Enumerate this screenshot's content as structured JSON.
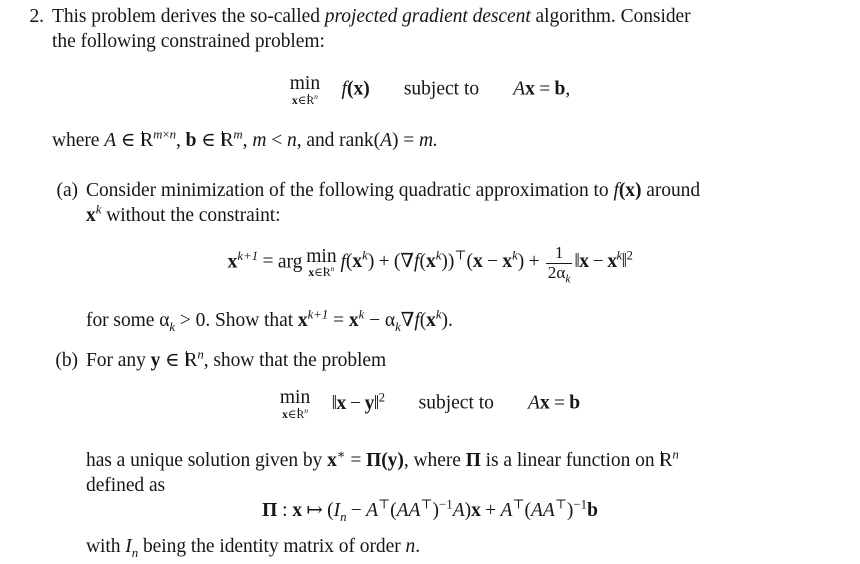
{
  "document": {
    "type": "math-exercise",
    "background_color": "#ffffff",
    "text_color": "#15161c",
    "problem_number": "2.",
    "intro": {
      "line1_before_italic": "This problem derives the so-called ",
      "line1_italic": "projected gradient descent",
      "line1_after_italic": " algorithm.  Consider",
      "line2": "the following constrained problem:"
    },
    "display1": {
      "min_label": "min",
      "min_sub_var": "x",
      "min_sub_in": "∈",
      "min_sub_set": "R",
      "min_sub_exp": "n",
      "objective_f": "f",
      "objective_arg": "(x)",
      "connector": "subject to",
      "constraint_A": "A",
      "constraint_x": "x",
      "constraint_eq": "=",
      "constraint_b": "b",
      "constraint_punct": ","
    },
    "where_line": {
      "lead": "where ",
      "A": "A",
      "in1": " ∈ ",
      "set1": "R",
      "set1_exp_m": "m",
      "set1_exp_times": "×",
      "set1_exp_n": "n",
      "comma1": ", ",
      "b": "b",
      "in2": " ∈ ",
      "set2": "R",
      "set2_exp": "m",
      "comma2": ", ",
      "m": "m",
      "lt": " < ",
      "n": "n",
      "comma3": ", and ",
      "rank": "rank",
      "rank_arg": "(A)",
      "eq": " = ",
      "rhs": "m."
    },
    "parts": [
      {
        "label": "(a)",
        "text_line1_a": "Consider minimization of the following quadratic approximation to ",
        "text_line1_f": "f",
        "text_line1_fx": "(x)",
        "text_line1_b": " around",
        "text_line2_x": "x",
        "text_line2_sup": "k",
        "text_line2_rest": " without the constraint:",
        "display": {
          "lhs_x": "x",
          "lhs_sup": "k+1",
          "eq": "=",
          "arg": "arg",
          "min_label": "min",
          "min_sub_var": "x",
          "min_sub_in": "∈",
          "min_sub_set": "R",
          "min_sub_exp": "n",
          "t1_f": "f",
          "t1_arg_x": "x",
          "t1_arg_sup": "k",
          "plus1": "+",
          "t2_grad": "∇",
          "t2_f": "f",
          "t2_arg_x": "x",
          "t2_arg_sup": "k",
          "t2_transpose": "⊤",
          "t2_tail_x": "x",
          "t2_tail_minus": "−",
          "t2_tail_xk": "x",
          "t2_tail_sup": "k",
          "plus2": "+",
          "frac_num": "1",
          "frac_den_2": "2",
          "frac_den_alpha": "α",
          "frac_den_sub": "k",
          "norm_open": "‖",
          "norm_x": "x",
          "norm_minus": "−",
          "norm_xk": "x",
          "norm_xk_sup": "k",
          "norm_close": "‖",
          "norm_sup": "2"
        },
        "tail_line": {
          "lead": "for some ",
          "alpha": "α",
          "alpha_sub": "k",
          "gt": " > 0.  Show that ",
          "x1": "x",
          "x1_sup": "k+1",
          "eq": " = ",
          "x2": "x",
          "x2_sup": "k",
          "minus": " − ",
          "alpha2": "α",
          "alpha2_sub": "k",
          "grad": "∇",
          "f": "f",
          "farg_x": "x",
          "farg_sup": "k",
          "end": ")."
        }
      },
      {
        "label": "(b)",
        "text_line1_a": "For any ",
        "text_line1_y": "y",
        "text_line1_in": " ∈ ",
        "text_line1_set": "R",
        "text_line1_exp": "n",
        "text_line1_b": ", show that the problem",
        "display": {
          "min_label": "min",
          "min_sub_var": "x",
          "min_sub_in": "∈",
          "min_sub_set": "R",
          "min_sub_exp": "n",
          "norm_open": "‖",
          "norm_x": "x",
          "norm_minus": "−",
          "norm_y": "y",
          "norm_close": "‖",
          "norm_sup": "2",
          "connector": "subject to",
          "constraint_A": "A",
          "constraint_x": "x",
          "constraint_eq": "=",
          "constraint_b": "b"
        },
        "tail_line1": {
          "lead": "has a unique solution given by ",
          "xstar_x": "x",
          "xstar_sup": "∗",
          "eq": " = ",
          "pi": "Π",
          "pi_arg": "(y)",
          "mid": ", where ",
          "pi2": "Π",
          "tail": " is a linear function on ",
          "set": "R",
          "set_exp": "n"
        },
        "tail_line2": "defined as",
        "pi_definition": {
          "pi": "Π",
          "colon": " : ",
          "x": "x",
          "mapsto": "↦",
          "open": "(",
          "I": "I",
          "I_sub": "n",
          "minus": "−",
          "A1": "A",
          "A1_sup": "⊤",
          "inner_open": "(",
          "AA": "AA",
          "AA_sup": "⊤",
          "inner_close": ")",
          "inv": "−1",
          "A2": "A",
          "close": ")",
          "x2": "x",
          "plus": "+",
          "A3": "A",
          "A3_sup": "⊤",
          "inner2_open": "(",
          "AA2": "AA",
          "AA2_sup": "⊤",
          "inner2_close": ")",
          "inv2": "−1",
          "b": "b"
        },
        "final_line": {
          "lead": "with ",
          "I": "I",
          "I_sub": "n",
          "rest": " being the identity matrix of order ",
          "n": "n",
          "period": "."
        }
      }
    ]
  }
}
